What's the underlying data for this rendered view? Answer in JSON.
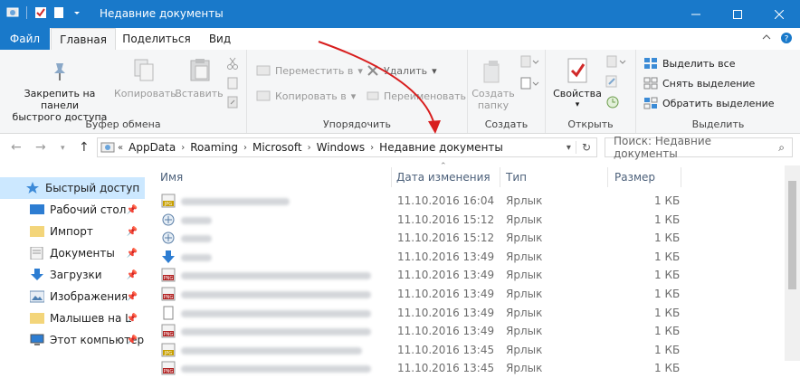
{
  "window": {
    "title": "Недавние документы"
  },
  "tabs": {
    "file": "Файл",
    "home": "Главная",
    "share": "Поделиться",
    "view": "Вид"
  },
  "ribbon": {
    "clipboard": {
      "pin_label_1": "Закрепить на панели",
      "pin_label_2": "быстрого доступа",
      "copy": "Копировать",
      "paste": "Вставить",
      "group": "Буфер обмена"
    },
    "organize": {
      "move": "Переместить в",
      "copy_to": "Копировать в",
      "delete": "Удалить",
      "rename": "Переименовать",
      "group": "Упорядочить"
    },
    "new": {
      "folder_1": "Создать",
      "folder_2": "папку",
      "group": "Создать"
    },
    "open": {
      "properties": "Свойства",
      "group": "Открыть"
    },
    "select": {
      "select_all": "Выделить все",
      "select_none": "Снять выделение",
      "invert": "Обратить выделение",
      "group": "Выделить"
    }
  },
  "address": {
    "crumbs": [
      "AppData",
      "Roaming",
      "Microsoft",
      "Windows",
      "Недавние документы"
    ],
    "search_placeholder": "Поиск: Недавние документы"
  },
  "nav": {
    "items": [
      {
        "label": "Быстрый доступ",
        "icon": "star-icon"
      },
      {
        "label": "Рабочий стол",
        "icon": "desktop-icon"
      },
      {
        "label": "Импорт",
        "icon": "folder-icon"
      },
      {
        "label": "Документы",
        "icon": "documents-icon"
      },
      {
        "label": "Загрузки",
        "icon": "downloads-icon"
      },
      {
        "label": "Изображения",
        "icon": "pictures-icon"
      },
      {
        "label": "Малышев на L",
        "icon": "folder-icon"
      },
      {
        "label": "Этот компьютер",
        "icon": "computer-icon"
      }
    ]
  },
  "list": {
    "headers": {
      "name": "Имя",
      "date": "Дата изменения",
      "type": "Тип",
      "size": "Размер"
    },
    "rows": [
      {
        "icon": "jpg-icon",
        "date": "11.10.2016 16:04",
        "type": "Ярлык",
        "size": "1 КБ"
      },
      {
        "icon": "network-icon",
        "date": "11.10.2016 15:12",
        "type": "Ярлык",
        "size": "1 КБ"
      },
      {
        "icon": "network-icon",
        "date": "11.10.2016 15:12",
        "type": "Ярлык",
        "size": "1 КБ"
      },
      {
        "icon": "download-icon",
        "date": "11.10.2016 13:49",
        "type": "Ярлык",
        "size": "1 КБ"
      },
      {
        "icon": "png-icon",
        "date": "11.10.2016 13:49",
        "type": "Ярлык",
        "size": "1 КБ"
      },
      {
        "icon": "png-icon",
        "date": "11.10.2016 13:49",
        "type": "Ярлык",
        "size": "1 КБ"
      },
      {
        "icon": "blank-doc-icon",
        "date": "11.10.2016 13:49",
        "type": "Ярлык",
        "size": "1 КБ"
      },
      {
        "icon": "png-icon",
        "date": "11.10.2016 13:49",
        "type": "Ярлык",
        "size": "1 КБ"
      },
      {
        "icon": "jpg-icon",
        "date": "11.10.2016 13:45",
        "type": "Ярлык",
        "size": "1 КБ"
      },
      {
        "icon": "png-icon",
        "date": "11.10.2016 13:45",
        "type": "Ярлык",
        "size": "1 КБ"
      }
    ]
  },
  "colors": {
    "titlebar": "#1979ca",
    "accent_arrow": "#d81e1e",
    "selection": "#cce8ff"
  }
}
